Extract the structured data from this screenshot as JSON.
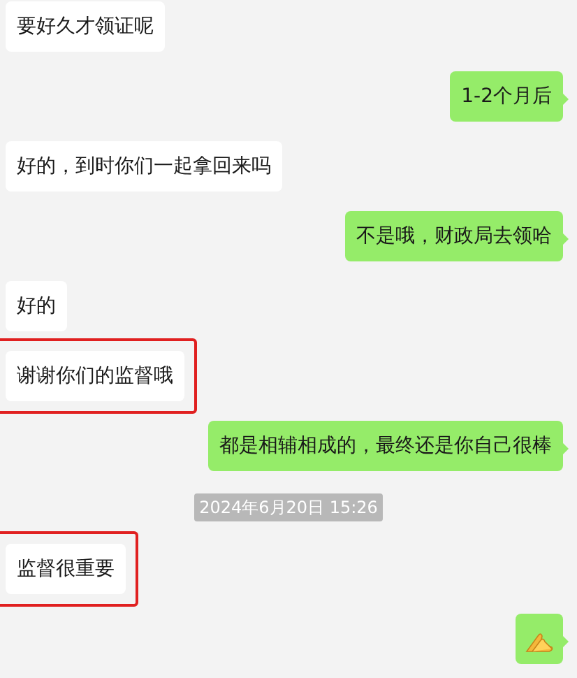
{
  "messages": [
    {
      "kind": "text",
      "outgoing": false,
      "text": "要好久才领证呢",
      "highlighted": false
    },
    {
      "kind": "text",
      "outgoing": true,
      "text": "1-2个月后",
      "highlighted": false
    },
    {
      "kind": "text",
      "outgoing": false,
      "text": "好的，到时你们一起拿回来吗",
      "highlighted": false
    },
    {
      "kind": "text",
      "outgoing": true,
      "text": "不是哦，财政局去领哈",
      "highlighted": false
    },
    {
      "kind": "text",
      "outgoing": false,
      "text": "好的",
      "highlighted": false
    },
    {
      "kind": "text",
      "outgoing": false,
      "text": "谢谢你们的监督哦",
      "highlighted": true
    },
    {
      "kind": "text",
      "outgoing": true,
      "text": "都是相辅相成的，最终还是你自己很棒",
      "highlighted": false
    },
    {
      "kind": "time",
      "text": "2024年6月20日 15:26"
    },
    {
      "kind": "text",
      "outgoing": false,
      "text": "监督很重要",
      "highlighted": true
    },
    {
      "kind": "emoji",
      "outgoing": true,
      "highlighted": false
    }
  ]
}
